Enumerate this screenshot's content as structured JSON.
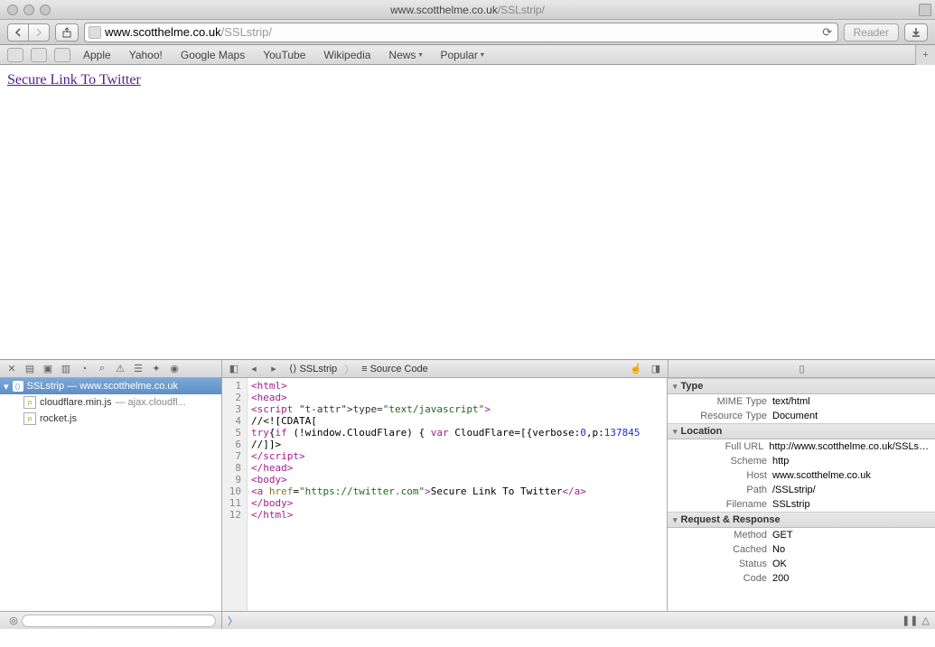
{
  "window": {
    "title_host": "www.scotthelme.co.uk",
    "title_path": "/SSLstrip/"
  },
  "toolbar": {
    "address_host": "www.scotthelme.co.uk",
    "address_path": "/SSLstrip/",
    "reload_glyph": "⟳",
    "reader_label": "Reader"
  },
  "bookmarks": {
    "items": [
      "Apple",
      "Yahoo!",
      "Google Maps",
      "YouTube",
      "Wikipedia",
      "News",
      "Popular"
    ]
  },
  "page": {
    "link_text": "Secure Link To Twitter",
    "link_href": "https://twitter.com"
  },
  "devtools": {
    "breadcrumb": [
      "SSLstrip",
      "Source Code"
    ],
    "tree": {
      "root": "SSLstrip — www.scotthelme.co.uk",
      "children": [
        {
          "name": "cloudflare.min.js",
          "detail": "— ajax.cloudfl..."
        },
        {
          "name": "rocket.js",
          "detail": ""
        }
      ]
    },
    "source_lines": [
      {
        "n": 1,
        "raw": "<html>"
      },
      {
        "n": 2,
        "raw": "<head>"
      },
      {
        "n": 3,
        "raw": "<script type=\"text/javascript\">"
      },
      {
        "n": 4,
        "raw": "//<![CDATA["
      },
      {
        "n": 5,
        "raw": "try{if (!window.CloudFlare) { var CloudFlare=[{verbose:0,p:137845..."
      },
      {
        "n": 6,
        "raw": "//]]>"
      },
      {
        "n": 7,
        "raw": "</script_>"
      },
      {
        "n": 8,
        "raw": "</head>"
      },
      {
        "n": 9,
        "raw": "<body>"
      },
      {
        "n": 10,
        "raw": "<a href=\"https://twitter.com\">Secure Link To Twitter</a>"
      },
      {
        "n": 11,
        "raw": "</body>"
      },
      {
        "n": 12,
        "raw": "</html>"
      }
    ],
    "details": {
      "sections": [
        {
          "title": "Type",
          "rows": [
            {
              "k": "MIME Type",
              "v": "text/html"
            },
            {
              "k": "Resource Type",
              "v": "Document"
            }
          ]
        },
        {
          "title": "Location",
          "rows": [
            {
              "k": "Full URL",
              "v": "http://www.scotthelme.co.uk/SSLstrip/"
            },
            {
              "k": "Scheme",
              "v": "http"
            },
            {
              "k": "Host",
              "v": "www.scotthelme.co.uk"
            },
            {
              "k": "Path",
              "v": "/SSLstrip/"
            },
            {
              "k": "Filename",
              "v": "SSLstrip"
            }
          ]
        },
        {
          "title": "Request & Response",
          "rows": [
            {
              "k": "Method",
              "v": "GET"
            },
            {
              "k": "Cached",
              "v": "No"
            },
            {
              "k": "Status",
              "v": "OK"
            },
            {
              "k": "Code",
              "v": "200"
            }
          ]
        }
      ]
    }
  }
}
